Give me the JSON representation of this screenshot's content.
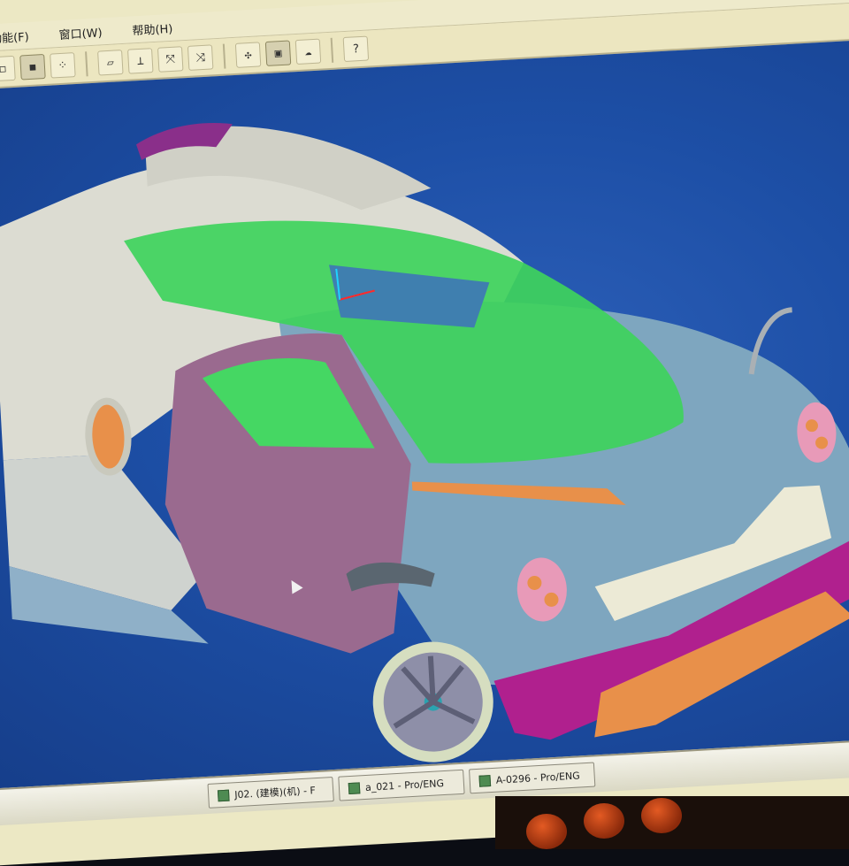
{
  "menu": [
    "功能(F)",
    "窗口(W)",
    "帮助(H)"
  ],
  "toolbar": {
    "groups": [
      [
        "frame-view-icon",
        "shaded-view-icon",
        "tree-view-icon"
      ],
      [
        "plane-icon",
        "axis-icon",
        "datum-icon",
        "datum-axes-icon"
      ],
      [
        "select-icon",
        "fit-view-icon",
        "spin-icon"
      ],
      [
        "help-icon"
      ]
    ],
    "labels": [
      "◻",
      "◼",
      "⁘",
      "▱",
      "⟂",
      "⤧",
      "⤨",
      "✣",
      "▣",
      "☁",
      "?"
    ]
  },
  "viewport": {
    "background": "#1d4fa6",
    "model": "sports-car"
  },
  "colors": {
    "body_white": "#dcdcd2",
    "body_teal": "#7ea6bf",
    "door_purple": "#9a6a8f",
    "glass_green": "#39d65a",
    "accent_magenta": "#b0208e",
    "accent_orange": "#e8904a"
  },
  "taskbar": {
    "items": [
      "J02. (建模)(机) - F",
      "a_021 - Pro/ENG",
      "A-0296 - Pro/ENG"
    ]
  }
}
